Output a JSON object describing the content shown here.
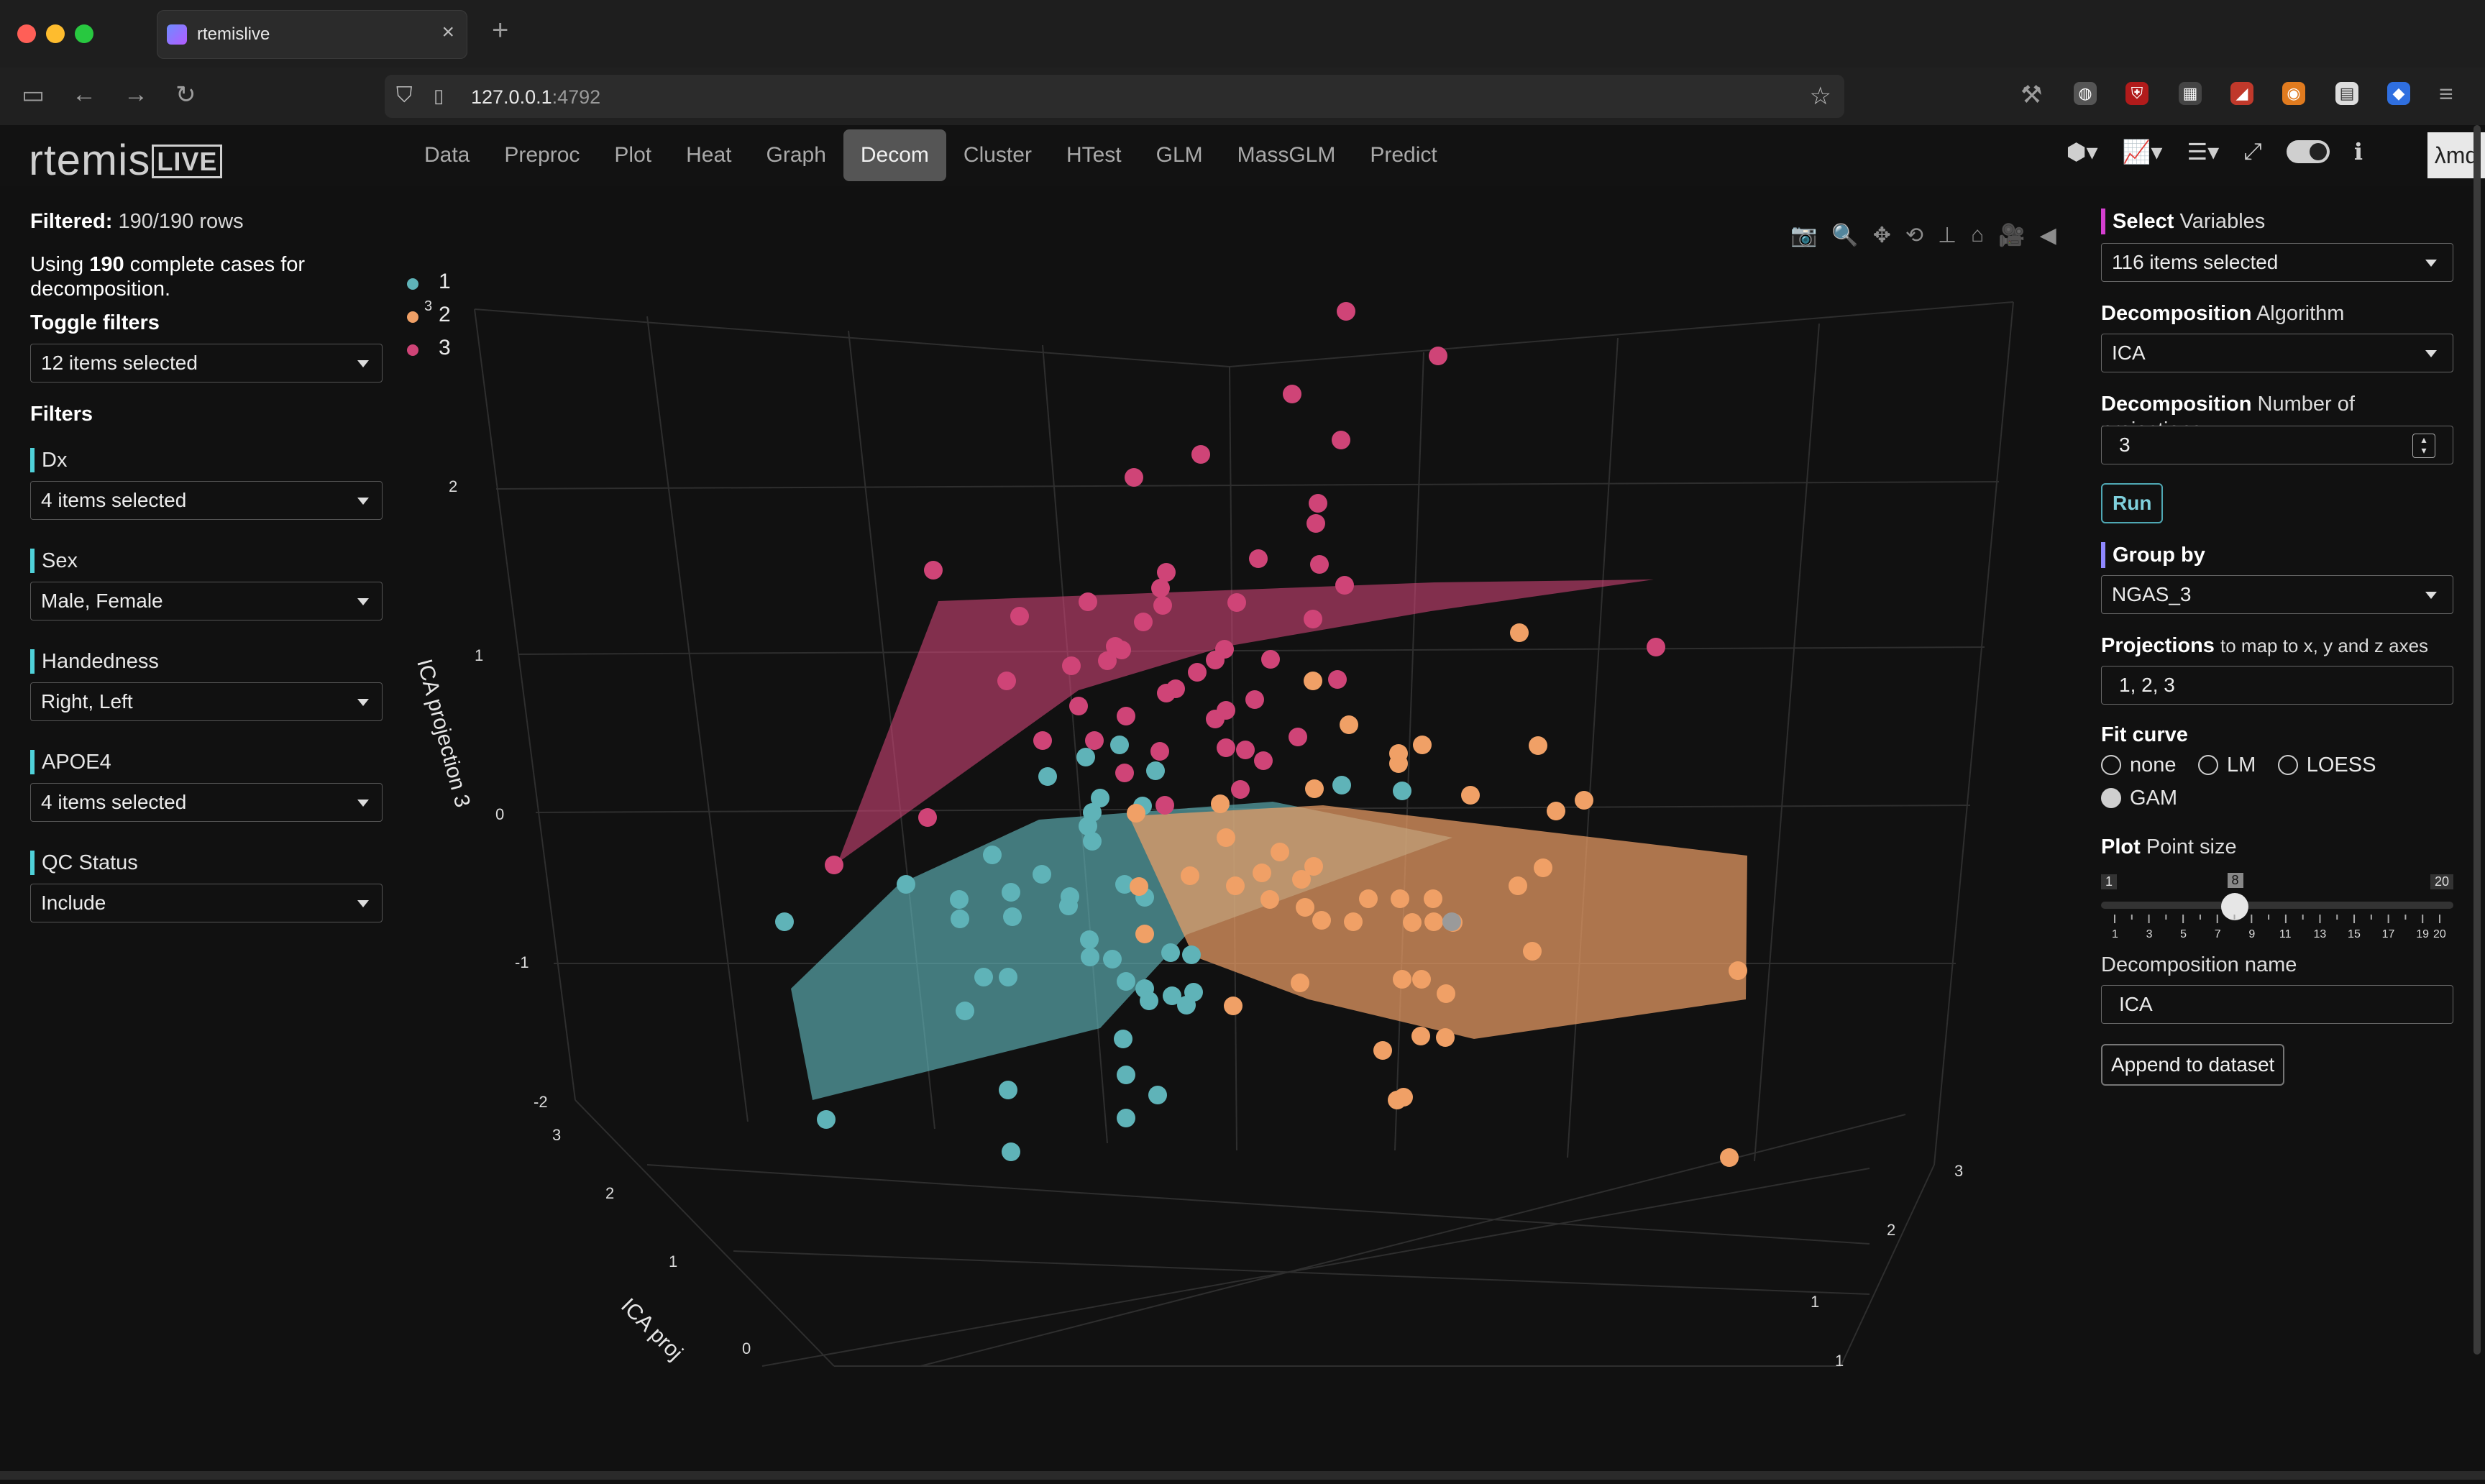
{
  "browser": {
    "tab_title": "rtemislive",
    "url_host": "127.0.0.1",
    "url_port": ":4792"
  },
  "app": {
    "logo_main": "rtemis",
    "logo_live": "LIVE",
    "nav": [
      "Data",
      "Preproc",
      "Plot",
      "Heat",
      "Graph",
      "Decom",
      "Cluster",
      "HTest",
      "GLM",
      "MassGLM",
      "Predict"
    ],
    "active_nav": "Decom",
    "lambda_label": "λmd"
  },
  "left": {
    "filtered_label": "Filtered:",
    "filtered_value": "190/190 rows",
    "using_prefix": "Using",
    "using_count": "190",
    "using_suffix": "complete cases for decomposition.",
    "toggle_filters_label": "Toggle filters",
    "toggle_filters_value": "12 items selected",
    "filters_label": "Filters",
    "filters": [
      {
        "name": "Dx",
        "value": "4 items selected"
      },
      {
        "name": "Sex",
        "value": "Male, Female"
      },
      {
        "name": "Handedness",
        "value": "Right, Left"
      },
      {
        "name": "APOE4",
        "value": "4 items selected"
      },
      {
        "name": "QC Status",
        "value": "Include"
      }
    ]
  },
  "right": {
    "select_vars_bold": "Select",
    "select_vars_rest": "Variables",
    "select_vars_value": "116 items selected",
    "algo_bold": "Decomposition",
    "algo_rest": "Algorithm",
    "algo_value": "ICA",
    "nproj_bold": "Decomposition",
    "nproj_rest": "Number of projections",
    "nproj_value": "3",
    "run_label": "Run",
    "group_bold": "Group by",
    "group_value": "NGAS_3",
    "proj_bold": "Projections",
    "proj_rest": "to map to x, y and z axes",
    "proj_value": "1, 2, 3",
    "fit_label": "Fit curve",
    "fit_options": [
      "none",
      "LM",
      "LOESS",
      "GAM"
    ],
    "fit_selected": "GAM",
    "point_bold": "Plot",
    "point_rest": "Point size",
    "point_min": "1",
    "point_max": "20",
    "point_value": 8,
    "point_value_label": "8",
    "point_ticks": [
      "1",
      "3",
      "5",
      "7",
      "9",
      "11",
      "13",
      "15",
      "17",
      "19",
      "20"
    ],
    "decomp_name_label": "Decomposition name",
    "decomp_name_value": "ICA",
    "append_label": "Append to dataset"
  },
  "chart_data": {
    "type": "scatter",
    "title": "",
    "zlabel": "ICA projection 3",
    "xlabel": "ICA proj",
    "legend_title": "3",
    "legend": [
      {
        "name": "1",
        "color": "#5fb3b8"
      },
      {
        "name": "2",
        "color": "#f0a066"
      },
      {
        "name": "3",
        "color": "#cf4477"
      }
    ],
    "z_ticks": [
      "2",
      "1",
      "0",
      "-1",
      "-2"
    ],
    "x_ticks": [
      "3",
      "2",
      "1",
      "0"
    ],
    "y_ticks": [
      "3",
      "2",
      "1",
      "1"
    ],
    "fit": "GAM"
  }
}
